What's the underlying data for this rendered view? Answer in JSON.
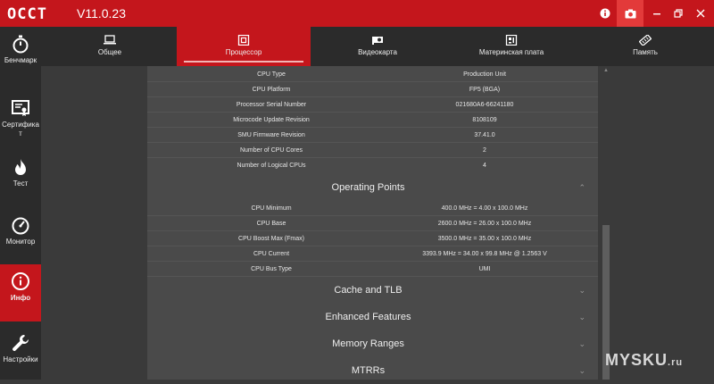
{
  "app": {
    "logo": "OCCT",
    "version": "V11.0.23"
  },
  "sidebar": {
    "items": [
      {
        "label": "Бенчмарк",
        "icon": "stopwatch-icon"
      },
      {
        "label": "Сертифика\nт",
        "icon": "certificate-icon"
      },
      {
        "label": "Тест",
        "icon": "flame-icon"
      },
      {
        "label": "Монитор",
        "icon": "gauge-icon"
      },
      {
        "label": "Инфо",
        "icon": "info-icon"
      },
      {
        "label": "Настройки",
        "icon": "wrench-icon"
      }
    ]
  },
  "tabs": [
    {
      "label": "Общее",
      "icon": "laptop-icon"
    },
    {
      "label": "Процессор",
      "icon": "cpu-icon"
    },
    {
      "label": "Видеокарта",
      "icon": "gpu-icon"
    },
    {
      "label": "Материнская плата",
      "icon": "motherboard-icon"
    },
    {
      "label": "Память",
      "icon": "memory-icon"
    }
  ],
  "cpu_rows": [
    {
      "k": "CPU Type",
      "v": "Production Unit"
    },
    {
      "k": "CPU Platform",
      "v": "FP5 (BGA)"
    },
    {
      "k": "Processor Serial Number",
      "v": "021680A6-66241180"
    },
    {
      "k": "Microcode Update Revision",
      "v": "8108109"
    },
    {
      "k": "SMU Firmware Revision",
      "v": "37.41.0"
    },
    {
      "k": "Number of CPU Cores",
      "v": "2"
    },
    {
      "k": "Number of Logical CPUs",
      "v": "4"
    }
  ],
  "operating_points": {
    "title": "Operating Points",
    "rows": [
      {
        "k": "CPU Minimum",
        "v": "400.0 MHz = 4.00 x 100.0 MHz"
      },
      {
        "k": "CPU Base",
        "v": "2600.0 MHz = 26.00 x 100.0 MHz"
      },
      {
        "k": "CPU Boost Max (Fmax)",
        "v": "3500.0 MHz = 35.00 x 100.0 MHz"
      },
      {
        "k": "CPU Current",
        "v": "3393.9 MHz = 34.00 x 99.8 MHz @ 1.2563 V"
      },
      {
        "k": "CPU Bus Type",
        "v": "UMI"
      }
    ]
  },
  "sections": [
    {
      "title": "Cache and TLB"
    },
    {
      "title": "Enhanced Features"
    },
    {
      "title": "Memory Ranges"
    },
    {
      "title": "MTRRs"
    }
  ],
  "watermark": {
    "text": "MYSKU",
    "suffix": ".ru"
  },
  "colors": {
    "accent": "#c4161c",
    "background": "#3a3a3a",
    "panel": "#4a4a4a"
  }
}
